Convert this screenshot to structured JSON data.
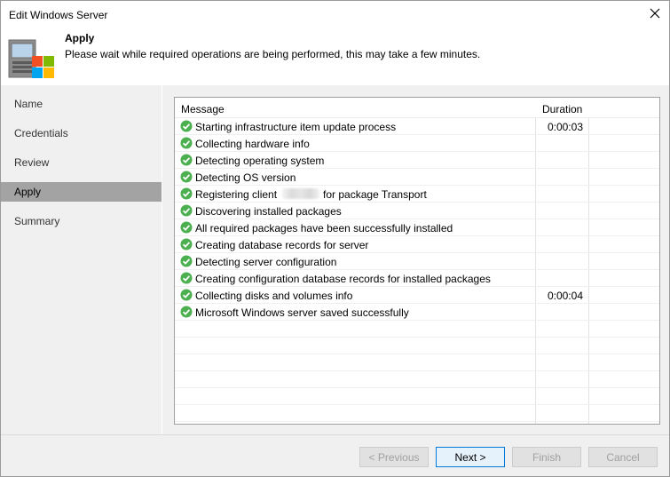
{
  "window": {
    "title": "Edit Windows Server"
  },
  "header": {
    "title": "Apply",
    "description": "Please wait while required operations are being performed, this may take a few minutes."
  },
  "sidebar": {
    "items": [
      {
        "label": "Name"
      },
      {
        "label": "Credentials"
      },
      {
        "label": "Review"
      },
      {
        "label": "Apply",
        "active": true
      },
      {
        "label": "Summary"
      }
    ]
  },
  "grid": {
    "columns": {
      "message": "Message",
      "duration": "Duration"
    },
    "rows": [
      {
        "message": "Starting infrastructure item update process",
        "duration": "0:00:03"
      },
      {
        "message": "Collecting hardware info",
        "duration": ""
      },
      {
        "message": "Detecting operating system",
        "duration": ""
      },
      {
        "message": "Detecting OS version",
        "duration": ""
      },
      {
        "message_prefix": "Registering client",
        "message_suffix": "for package Transport",
        "duration": ""
      },
      {
        "message": "Discovering installed packages",
        "duration": ""
      },
      {
        "message": "All required packages have been successfully installed",
        "duration": ""
      },
      {
        "message": "Creating database records for server",
        "duration": ""
      },
      {
        "message": "Detecting server configuration",
        "duration": ""
      },
      {
        "message": "Creating configuration database records for installed packages",
        "duration": ""
      },
      {
        "message": "Collecting disks and volumes info",
        "duration": "0:00:04"
      },
      {
        "message": "Microsoft Windows server saved successfully",
        "duration": ""
      }
    ],
    "status_icon": "success-check-icon",
    "status_color": "#4caf50"
  },
  "footer": {
    "previous_label": "< Previous",
    "next_label": "Next >",
    "finish_label": "Finish",
    "cancel_label": "Cancel"
  },
  "colors": {
    "accent": "#0078d7",
    "active_nav": "#a3a3a3"
  }
}
